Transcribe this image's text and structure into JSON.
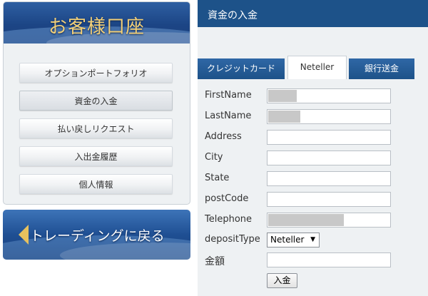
{
  "sidebar": {
    "title": "お客様口座",
    "menu": [
      {
        "label": "オプションポートフォリオ"
      },
      {
        "label": "資金の入金"
      },
      {
        "label": "払い戻しリクエスト"
      },
      {
        "label": "入出金履歴"
      },
      {
        "label": "個人情報"
      }
    ],
    "back_label": "トレーディングに戻る"
  },
  "main": {
    "title": "資金の入金",
    "tabs": [
      {
        "label": "クレジットカード"
      },
      {
        "label": "Neteller"
      },
      {
        "label": "銀行送金"
      }
    ],
    "fields": {
      "first_name": {
        "label": "FirstName",
        "value": ""
      },
      "last_name": {
        "label": "LastName",
        "value": ""
      },
      "address": {
        "label": "Address",
        "value": ""
      },
      "city": {
        "label": "City",
        "value": ""
      },
      "state": {
        "label": "State",
        "value": ""
      },
      "post_code": {
        "label": "postCode",
        "value": ""
      },
      "telephone": {
        "label": "Telephone",
        "value": ""
      },
      "deposit_type": {
        "label": "depositType",
        "value": "Neteller"
      },
      "amount": {
        "label": "金額",
        "value": ""
      }
    },
    "submit_label": "入金"
  },
  "colors": {
    "header_blue": "#1d5289",
    "title_gold": "#f2cf77",
    "panel_bg": "#eef1f3"
  }
}
